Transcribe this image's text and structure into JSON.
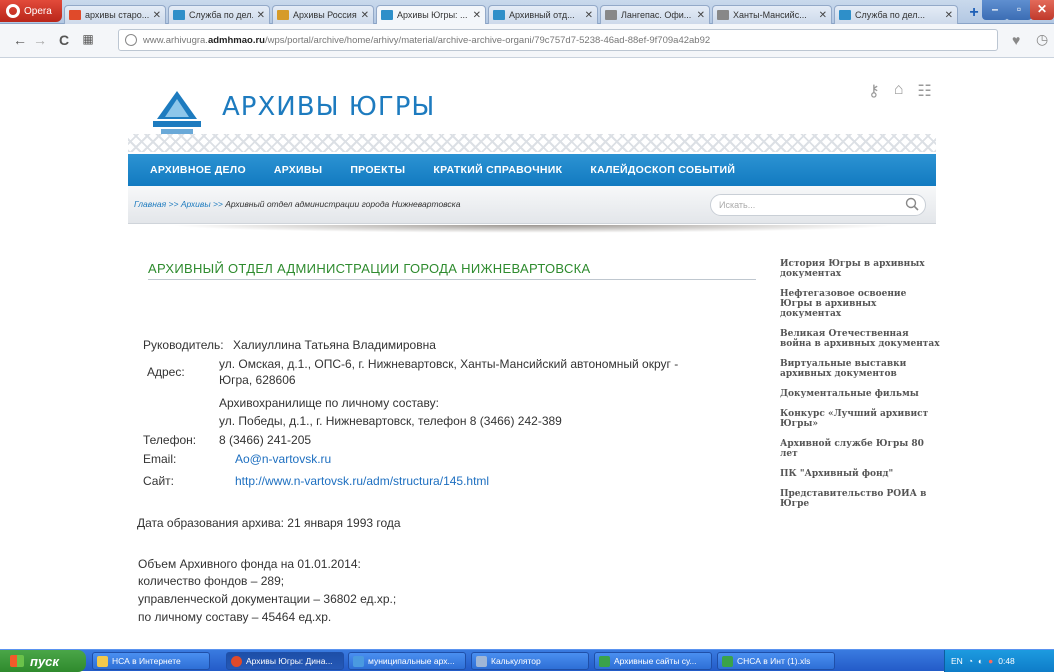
{
  "browser": {
    "opera_label": "Opera",
    "tabs": [
      {
        "title": "архивы старо...",
        "color": "#e04a2a"
      },
      {
        "title": "Служба по дел...",
        "color": "#2e8fc9"
      },
      {
        "title": "Архивы Россия...",
        "color": "#d69b2a"
      },
      {
        "title": "Архивы Югры: ...",
        "color": "#2e8fc9"
      },
      {
        "title": "Архивный отд...",
        "color": "#2e8fc9"
      },
      {
        "title": "Лангепас. Офи...",
        "color": "#888888"
      },
      {
        "title": "Ханты-Мансийс...",
        "color": "#888888"
      },
      {
        "title": "Служба по дел...",
        "color": "#2e8fc9"
      }
    ],
    "new_tab": "+",
    "url_host_prefix": "www.arhivugra.",
    "url_host_bold": "admhmao.ru",
    "url_path": "/wps/portal/archive/home/arhivy/material/archive-archive-organi/79c757d7-5238-46ad-88ef-9f709a42ab92"
  },
  "site": {
    "title": "АРХИВЫ ЮГРЫ",
    "nav": [
      "АРХИВНОЕ ДЕЛО",
      "АРХИВЫ",
      "ПРОЕКТЫ",
      "КРАТКИЙ СПРАВОЧНИК",
      "КАЛЕЙДОСКОП СОБЫТИЙ"
    ],
    "breadcrumb": {
      "home": "Главная",
      "sep": " >> ",
      "archives": "Архивы",
      "current": "Архивный отдел администрации города Нижневартовска"
    },
    "search_placeholder": "Искать..."
  },
  "main": {
    "heading": "АРХИВНЫЙ ОТДЕЛ АДМИНИСТРАЦИИ ГОРОДА НИЖНЕВАРТОВСКА",
    "head_label": "Руководитель:",
    "head_value": "Халиуллина Татьяна Владимировна",
    "address_label": "Адрес:",
    "address_line1": "ул. Омская, д.1., ОПС-6, г. Нижневартовск, Ханты-Мансийский автономный округ -",
    "address_line2": "Югра, 628606",
    "address_line3": "Архивохранилище по личному составу:",
    "address_line4": "ул. Победы, д.1., г. Нижневартовск, телефон 8 (3466) 242-389",
    "phone_label": "Телефон:",
    "phone_value": "8 (3466) 241-205",
    "email_label": "Email:",
    "email_value": "Ao@n-vartovsk.ru",
    "site_label": "Сайт:",
    "site_value": "http://www.n-vartovsk.ru/adm/structura/145.html",
    "founded": "Дата образования архива: 21 января 1993 года",
    "fund_title": "Объем Архивного фонда на 01.01.2014:",
    "fund_line1": "количество фондов – 289;",
    "fund_line2": "управленческой документации – 36802 ед.хр.;",
    "fund_line3": "по личному составу – 45464 ед.хр."
  },
  "sidebar": [
    "История Югры в архивных документах",
    "Нефтегазовое освоение Югры в архивных документах",
    "Великая Отечественная война в архивных документах",
    "Виртуальные выставки архивных документов",
    "Документальные фильмы",
    "Конкурс «Лучший архивист Югры»",
    "Архивной службе Югры 80 лет",
    "ПК \"Архивный фонд\"",
    "Представительство РОИА в Югре"
  ],
  "taskbar": {
    "start": "пуск",
    "items": [
      {
        "label": "НСА в Интернете",
        "color": "#f2c94c"
      },
      {
        "label": "Архивы Югры: Дина...",
        "color": "#e04a2a"
      },
      {
        "label": "муниципальные арх...",
        "color": "#4a9ae0"
      },
      {
        "label": "Калькулятор",
        "color": "#9fb6d6"
      },
      {
        "label": "Архивные сайты су...",
        "color": "#3aa34a"
      },
      {
        "label": "СНСА в Инт (1).xls",
        "color": "#3aa34a"
      }
    ],
    "lang": "EN",
    "time": "0:48"
  }
}
